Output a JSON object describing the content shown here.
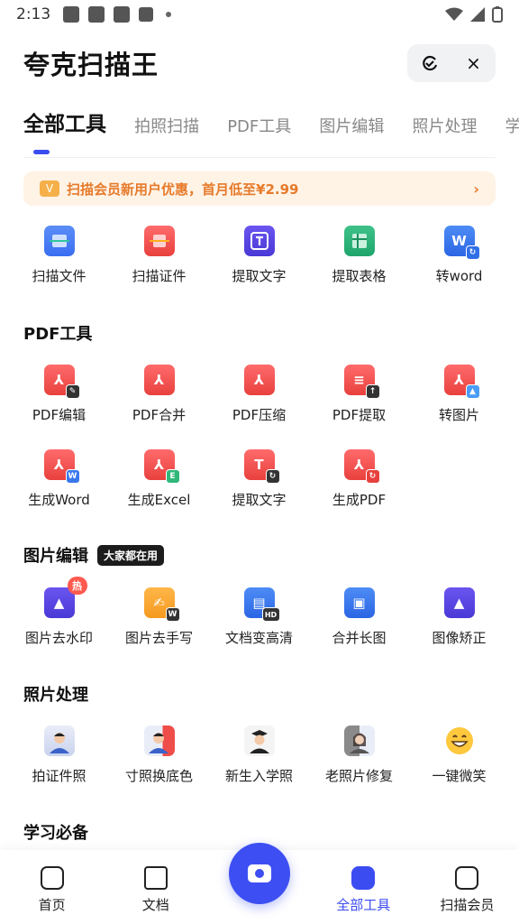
{
  "status_bar": {
    "time": "2:13"
  },
  "header": {
    "title": "夸克扫描王",
    "capsule_icons": [
      "refresh-icon",
      "close-icon"
    ],
    "close_glyph": "×"
  },
  "tabs": [
    "全部工具",
    "拍照扫描",
    "PDF工具",
    "图片编辑",
    "照片处理",
    "学习必备"
  ],
  "promo": {
    "text": "扫描会员新用户优惠，首月低至¥2.99",
    "icon_text": "V",
    "arrow": "›"
  },
  "quick_tools": [
    {
      "label": "扫描文件",
      "icon": "scan-file-icon",
      "color": "#4a7ef4"
    },
    {
      "label": "扫描证件",
      "icon": "scan-id-icon",
      "color": "#ef4d4a"
    },
    {
      "label": "提取文字",
      "icon": "extract-text-icon",
      "color": "#5543e3"
    },
    {
      "label": "提取表格",
      "icon": "extract-table-icon",
      "color": "#27b377"
    },
    {
      "label": "转word",
      "icon": "to-word-icon",
      "color": "#3877ec"
    }
  ],
  "pdf_section": {
    "title": "PDF工具",
    "row1": [
      {
        "label": "PDF编辑",
        "icon": "pdf-edit-icon"
      },
      {
        "label": "PDF合并",
        "icon": "pdf-merge-icon"
      },
      {
        "label": "PDF压缩",
        "icon": "pdf-compress-icon"
      },
      {
        "label": "PDF提取",
        "icon": "pdf-extract-icon"
      },
      {
        "label": "转图片",
        "icon": "pdf-to-image-icon"
      }
    ],
    "row2": [
      {
        "label": "生成Word",
        "icon": "gen-word-icon",
        "sub": "W"
      },
      {
        "label": "生成Excel",
        "icon": "gen-excel-icon",
        "sub": "E"
      },
      {
        "label": "提取文字",
        "icon": "pdf-extract-text-icon",
        "sub": "T"
      },
      {
        "label": "生成PDF",
        "icon": "gen-pdf-icon",
        "sub": "↻"
      }
    ]
  },
  "image_section": {
    "title": "图片编辑",
    "badge": "大家都在用",
    "items": [
      {
        "label": "图片去水印",
        "icon": "remove-watermark-icon",
        "hot": "热"
      },
      {
        "label": "图片去手写",
        "icon": "remove-handwriting-icon"
      },
      {
        "label": "文档变高清",
        "icon": "doc-hd-icon"
      },
      {
        "label": "合并长图",
        "icon": "merge-long-image-icon"
      },
      {
        "label": "图像矫正",
        "icon": "image-correct-icon"
      }
    ]
  },
  "photo_section": {
    "title": "照片处理",
    "items": [
      {
        "label": "拍证件照",
        "icon": "id-photo-icon"
      },
      {
        "label": "寸照换底色",
        "icon": "change-bg-icon"
      },
      {
        "label": "新生入学照",
        "icon": "graduate-photo-icon"
      },
      {
        "label": "老照片修复",
        "icon": "old-photo-repair-icon"
      },
      {
        "label": "一键微笑",
        "icon": "smile-icon"
      }
    ]
  },
  "study_section": {
    "title": "学习必备"
  },
  "bottom_nav": [
    {
      "label": "首页",
      "icon": "home-icon"
    },
    {
      "label": "文档",
      "icon": "folder-icon"
    },
    {
      "label": "全部工具",
      "icon": "all-tools-icon",
      "active": true
    },
    {
      "label": "扫描会员",
      "icon": "vip-icon"
    }
  ],
  "colors": {
    "accent": "#3b4cf0",
    "promo_text": "#e67a2a",
    "promo_bg": "#fff3e6"
  }
}
